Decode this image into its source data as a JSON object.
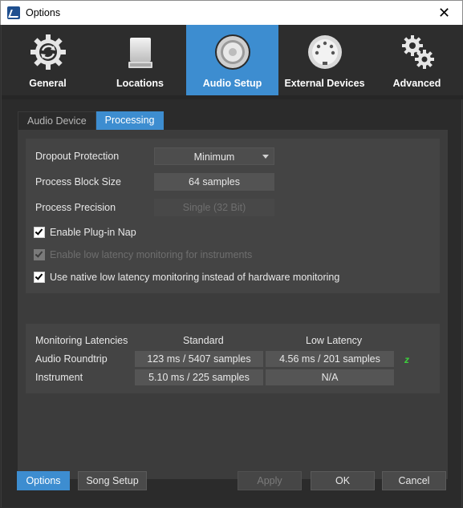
{
  "window": {
    "title": "Options",
    "close_glyph": "✕"
  },
  "topnav": [
    {
      "label": "General",
      "icon": "gear-refresh-icon",
      "active": false
    },
    {
      "label": "Locations",
      "icon": "drive-icon",
      "active": false
    },
    {
      "label": "Audio Setup",
      "icon": "speaker-icon",
      "active": true
    },
    {
      "label": "External Devices",
      "icon": "midi-port-icon",
      "active": false
    },
    {
      "label": "Advanced",
      "icon": "gears-icon",
      "active": false
    }
  ],
  "subtabs": [
    {
      "label": "Audio Device",
      "active": false
    },
    {
      "label": "Processing",
      "active": true
    }
  ],
  "processing": {
    "dropout_label": "Dropout Protection",
    "dropout_value": "Minimum",
    "block_label": "Process Block Size",
    "block_value": "64 samples",
    "precision_label": "Process Precision",
    "precision_value": "Single (32 Bit)",
    "nap_label": "Enable Plug-in Nap",
    "lowlat_instr_label": "Enable low latency monitoring for instruments",
    "native_lowlat_label": "Use native low latency monitoring instead of hardware monitoring"
  },
  "latency": {
    "header": "Monitoring Latencies",
    "col_standard": "Standard",
    "col_low": "Low Latency",
    "rows": [
      {
        "label": "Audio Roundtrip",
        "standard": "123 ms / 5407 samples",
        "low": "4.56 ms / 201 samples"
      },
      {
        "label": "Instrument",
        "standard": "5.10 ms / 225 samples",
        "low": "N/A"
      }
    ],
    "status_glyph": "z"
  },
  "footer": {
    "options": "Options",
    "song_setup": "Song Setup",
    "apply": "Apply",
    "ok": "OK",
    "cancel": "Cancel"
  },
  "colors": {
    "accent": "#3d8dd0",
    "status_green": "#3ccf3c"
  }
}
